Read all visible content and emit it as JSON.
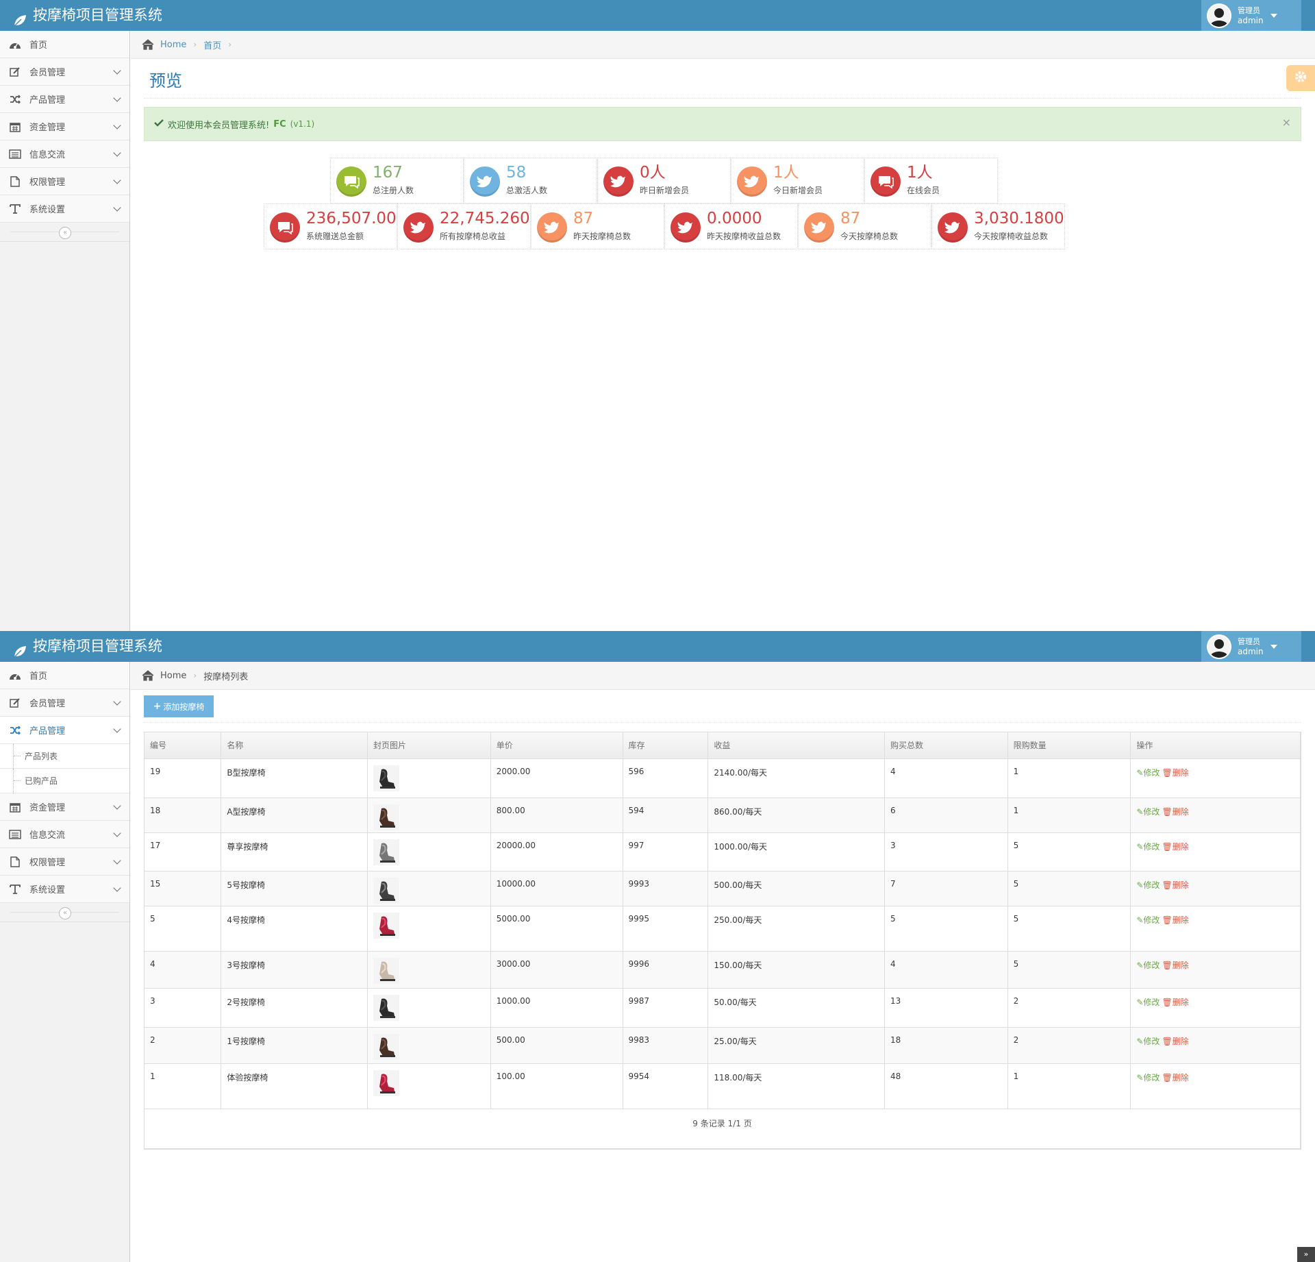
{
  "app": {
    "title": "按摩椅项目管理系统"
  },
  "user": {
    "role": "管理员",
    "name": "admin"
  },
  "sidebar": {
    "items": [
      {
        "label": "首页",
        "icon": "dashboard-icon"
      },
      {
        "label": "会员管理",
        "icon": "edit-icon"
      },
      {
        "label": "产品管理",
        "icon": "random-icon"
      },
      {
        "label": "资金管理",
        "icon": "calendar-icon"
      },
      {
        "label": "信息交流",
        "icon": "list-icon"
      },
      {
        "label": "权限管理",
        "icon": "file-icon"
      },
      {
        "label": "系统设置",
        "icon": "text-icon"
      }
    ],
    "submenu": [
      "产品列表",
      "已购产品"
    ],
    "collapse": "«"
  },
  "screen1": {
    "breadcrumb": [
      "Home",
      "首页"
    ],
    "page_title": "预览",
    "alert": {
      "text": "欢迎使用本会员管理系统!",
      "brand": "FC",
      "version": "(v1.1)",
      "close": "×"
    },
    "stats_row1": [
      {
        "value": "167",
        "label": "总注册人数",
        "color": "green",
        "icon": "comments-icon"
      },
      {
        "value": "58",
        "label": "总激活人数",
        "color": "blue",
        "icon": "twitter-icon"
      },
      {
        "value": "0人",
        "label": "昨日新增会员",
        "color": "red",
        "icon": "twitter-icon"
      },
      {
        "value": "1人",
        "label": "今日新增会员",
        "color": "orange",
        "icon": "twitter-icon"
      },
      {
        "value": "1人",
        "label": "在线会员",
        "color": "red",
        "icon": "comments-icon"
      }
    ],
    "stats_row2": [
      {
        "value": "236,507.00",
        "label": "系统赠送总金额",
        "color": "red",
        "icon": "comments-icon"
      },
      {
        "value": "22,745.2600",
        "label": "所有按摩椅总收益",
        "color": "red",
        "icon": "twitter-icon"
      },
      {
        "value": "87",
        "label": "昨天按摩椅总数",
        "color": "orange",
        "icon": "twitter-icon"
      },
      {
        "value": "0.0000",
        "label": "昨天按摩椅收益总数",
        "color": "red",
        "icon": "twitter-icon"
      },
      {
        "value": "87",
        "label": "今天按摩椅总数",
        "color": "orange",
        "icon": "twitter-icon"
      },
      {
        "value": "3,030.1800",
        "label": "今天按摩椅收益总数",
        "color": "red",
        "icon": "twitter-icon"
      }
    ]
  },
  "screen2": {
    "breadcrumb": [
      "Home",
      "按摩椅列表"
    ],
    "add_button": "添加按摩椅",
    "columns": [
      "编号",
      "名称",
      "封页图片",
      "单价",
      "库存",
      "收益",
      "购买总数",
      "限购数量",
      "操作"
    ],
    "rows": [
      {
        "id": "19",
        "name": "B型按摩椅",
        "chair": "black",
        "price": "2000.00",
        "stock": "596",
        "income": "2140.00/每天",
        "bought": "4",
        "limit": "1"
      },
      {
        "id": "18",
        "name": "A型按摩椅",
        "chair": "brown",
        "price": "800.00",
        "stock": "594",
        "income": "860.00/每天",
        "bought": "6",
        "limit": "1"
      },
      {
        "id": "17",
        "name": "尊享按摩椅",
        "chair": "grey",
        "price": "20000.00",
        "stock": "997",
        "income": "1000.00/每天",
        "bought": "3",
        "limit": "5"
      },
      {
        "id": "15",
        "name": "5号按摩椅",
        "chair": "darkgrey",
        "price": "10000.00",
        "stock": "9993",
        "income": "500.00/每天",
        "bought": "7",
        "limit": "5"
      },
      {
        "id": "5",
        "name": "4号按摩椅",
        "chair": "red",
        "price": "5000.00",
        "stock": "9995",
        "income": "250.00/每天",
        "bought": "5",
        "limit": "5"
      },
      {
        "id": "4",
        "name": "3号按摩椅",
        "chair": "beige",
        "price": "3000.00",
        "stock": "9996",
        "income": "150.00/每天",
        "bought": "4",
        "limit": "5"
      },
      {
        "id": "3",
        "name": "2号按摩椅",
        "chair": "black",
        "price": "1000.00",
        "stock": "9987",
        "income": "50.00/每天",
        "bought": "13",
        "limit": "2"
      },
      {
        "id": "2",
        "name": "1号按摩椅",
        "chair": "brown",
        "price": "500.00",
        "stock": "9983",
        "income": "25.00/每天",
        "bought": "18",
        "limit": "2"
      },
      {
        "id": "1",
        "name": "体验按摩椅",
        "chair": "red",
        "price": "100.00",
        "stock": "9954",
        "income": "118.00/每天",
        "bought": "48",
        "limit": "1"
      }
    ],
    "edit_label": "修改",
    "delete_label": "删除",
    "pager": "9 条记录 1/1 页",
    "scroll_top": "»"
  },
  "colors": {
    "navbar": "#438eb9",
    "green": "#82af6f",
    "blue": "#6fb3e0",
    "red": "#d53f40",
    "orange": "#f79263"
  }
}
